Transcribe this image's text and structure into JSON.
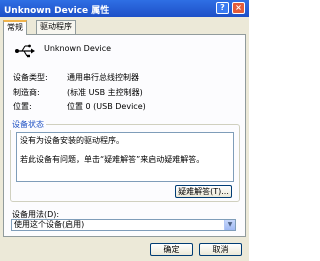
{
  "window": {
    "title": "Unknown Device 属性",
    "help_glyph": "?",
    "close_glyph": "×"
  },
  "tabs": [
    {
      "label": "常规",
      "active": true
    },
    {
      "label": "驱动程序",
      "active": false
    }
  ],
  "device": {
    "name": "Unknown Device",
    "icon": "usb-icon",
    "properties": [
      {
        "label": "设备类型:",
        "value": "通用串行总线控制器"
      },
      {
        "label": "制造商:",
        "value": "(标准 USB 主控制器)"
      },
      {
        "label": "位置:",
        "value": "位置 0 (USB Device)"
      }
    ]
  },
  "status": {
    "group_title": "设备状态",
    "lines": [
      "没有为设备安装的驱动程序。",
      "",
      "若此设备有问题，单击“疑难解答”来启动疑难解答。"
    ],
    "troubleshoot_button": "疑难解答(T)..."
  },
  "usage": {
    "label": "设备用法(D):",
    "selected": "使用这个设备(启用)"
  },
  "footer": {
    "ok": "确定",
    "cancel": "取消"
  },
  "colors": {
    "titlebar": "#1d4fc7",
    "panel": "#fcfcfe",
    "dialog": "#ece9d8",
    "group_title": "#1c4fc3"
  }
}
